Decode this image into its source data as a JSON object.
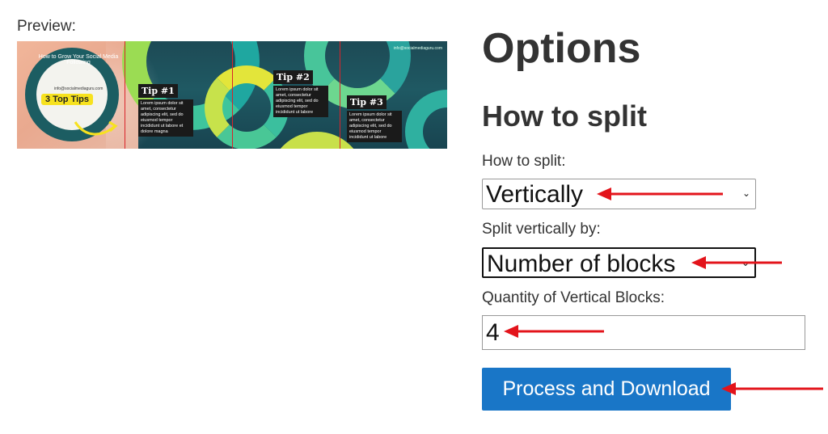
{
  "preview": {
    "label": "Preview:",
    "image": {
      "ring_text": "How to Grow Your Social Media Following",
      "contact_small": "info@socialmediaguru.com",
      "badge_text": "3 Top Tips",
      "email": "info@socialmediaguru.com",
      "tip1_title": "Tip #1",
      "tip1_body": "Lorem ipsum dolor sit amet, consectetur adipiscing elit, sed do eiusmod tempor incididunt ut labore et dolore magna",
      "tip2_title": "Tip #2",
      "tip2_body": "Lorem ipsum dolor sit amet, consectetur adipiscing elit, sed do eiusmod tempor incididunt ut labore",
      "tip3_title": "Tip #3",
      "tip3_body": "Lorem ipsum dolor sit amet, consectetur adipiscing elit, sed do eiusmod tempor incididunt ut labore"
    }
  },
  "options": {
    "title": "Options",
    "section_title": "How to split",
    "how_to_split": {
      "label": "How to split:",
      "value": "Vertically"
    },
    "split_by": {
      "label": "Split vertically by:",
      "value": "Number of blocks"
    },
    "quantity": {
      "label": "Quantity of Vertical Blocks:",
      "value": "4"
    },
    "submit_label": "Process and Download"
  },
  "colors": {
    "button": "#1976c7",
    "annotation_arrow": "#e3141b",
    "cut_line": "#d9232a"
  },
  "icons": {
    "select_chevron": "chevron-down-icon",
    "annotation": "red-arrow-icon"
  }
}
